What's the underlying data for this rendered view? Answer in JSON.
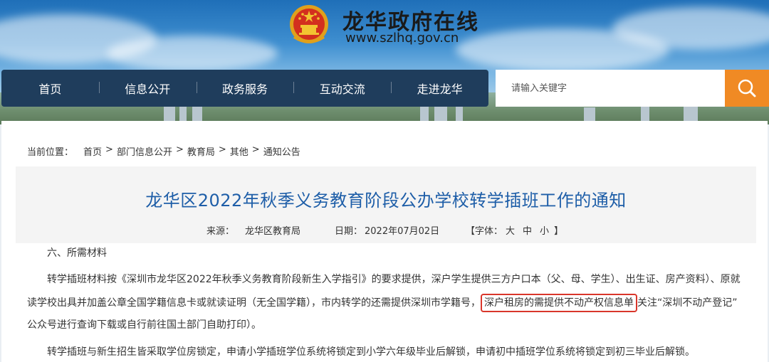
{
  "header": {
    "site_name": "龙华政府在线",
    "site_url": "www.szlhq.gov.cn"
  },
  "nav": {
    "items": [
      "首页",
      "信息公开",
      "政务服务",
      "互动交流",
      "走进龙华"
    ]
  },
  "search": {
    "placeholder": "请输入关键字"
  },
  "breadcrumb": {
    "label": "当前位置：",
    "items": [
      "首页",
      "部门信息公开",
      "教育局",
      "其他",
      "通知公告"
    ],
    "separator": ">"
  },
  "article": {
    "title": "龙华区2022年秋季义务教育阶段公办学校转学插班工作的通知",
    "source_label": "来源：",
    "source_value": "龙华区教育局",
    "date_label": "日期：",
    "date_value": "2022年07月02日",
    "font_label": "【字体：",
    "font_large": "大",
    "font_medium": "中",
    "font_small": "小",
    "font_close": "】",
    "section_heading": "六、所需材料",
    "para1_line1": "转学插班材料按《深圳市龙华区2022年秋季义务教育阶段新生入学指引》的要求提供，深户学生提供三方户口本（父、母、学生）、出生证、房产资料）、原就",
    "para1_line2_a": "读学校出具并加盖公章全国学籍信息卡或就读证明（无全国学籍），市内转学的还需提供深圳市学籍号，",
    "para1_line2_highlight": "深户租房的需提供不动产权信息单",
    "para1_line2_b": "关注“深圳不动产登记”",
    "para1_line3": "公众号进行查询下载或自行前往国土部门自助打印）。",
    "para2": "转学插班与新生招生皆采取学位房锁定，申请小学插班学位系统将锁定到小学六年级毕业后解锁，申请初中插班学位系统将锁定到初三毕业后解锁。"
  },
  "colors": {
    "nav_bg": "#1f3d5c",
    "search_button": "#f08a24",
    "title_blue": "#1e5ea8",
    "highlight_red": "#d9362b"
  }
}
